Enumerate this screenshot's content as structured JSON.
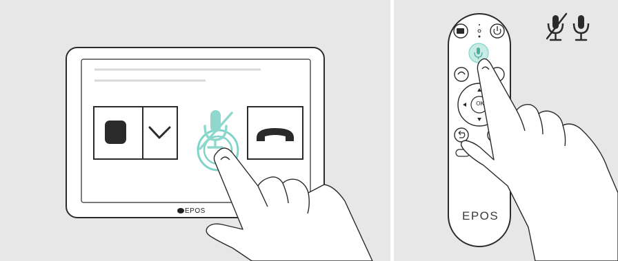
{
  "tablet": {
    "brand": "EPOS"
  },
  "remote": {
    "brand": "EPOS",
    "ok_label": "OK"
  },
  "colors": {
    "background": "#e7e7e7",
    "outline": "#2a2a2a",
    "accent_teal": "#7fd3c8",
    "accent_teal_light": "#c7ece6"
  },
  "icons": {
    "tablet_stop": "stop-icon",
    "tablet_dropdown": "chevron-down-icon",
    "tablet_mic": "microphone-muted-icon",
    "tablet_hangup": "phone-hangup-icon",
    "remote_teams": "teams-icon",
    "remote_power": "power-icon",
    "remote_mic": "microphone-icon",
    "remote_hangup": "phone-hangup-icon",
    "remote_back": "back-icon",
    "remote_cursor": "cursor-icon",
    "legend_muted": "microphone-muted-icon",
    "legend_unmuted": "microphone-icon"
  }
}
